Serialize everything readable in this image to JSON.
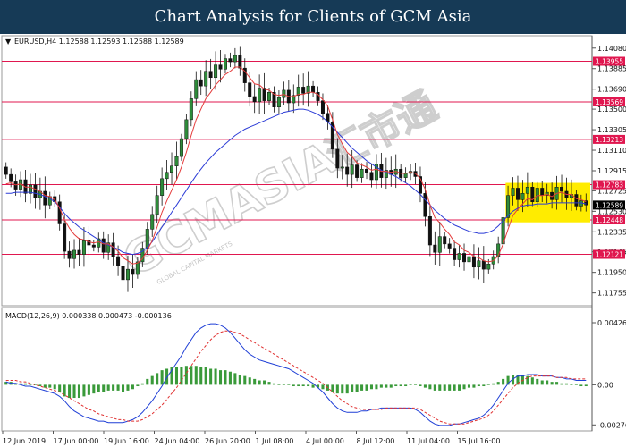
{
  "banner": {
    "title": "Chart Analysis for Clients of GCM Asia"
  },
  "watermark": {
    "brand": "GCMASIA",
    "chinese": "汇市通",
    "tagline": "GLOBAL CAPITAL MARKETS"
  },
  "colors": {
    "level_line": "#e0174f",
    "ma_fast": "#e43b3b",
    "ma_slow": "#2b3bd6",
    "candle_bull": "#2e8b3a",
    "candle_bear": "#111111",
    "macd_hist": "#3a9a3a",
    "macd_main": "#1f3fd6",
    "macd_signal": "#e03030",
    "highlight": "#ffec00",
    "banner_bg": "#163a56"
  },
  "chart_data": [
    {
      "type": "candlestick",
      "header": "EURUSD,H4  1.12588 1.12593 1.12588 1.12589",
      "ylim": [
        1.1165,
        1.1418
      ],
      "y_ticks": [
        "1.14080",
        "1.13885",
        "1.13690",
        "1.13500",
        "1.13305",
        "1.13110",
        "1.12915",
        "1.12725",
        "1.12530",
        "1.12335",
        "1.12145",
        "1.11950",
        "1.11755"
      ],
      "levels": [
        "1.13955",
        "1.13569",
        "1.13213",
        "1.12783",
        "1.12448",
        "1.12121"
      ],
      "current_price": "1.12589",
      "x_ticks": [
        "12 Jun 2019",
        "17 Jun 00:00",
        "19 Jun 16:00",
        "24 Jun 04:00",
        "26 Jun 20:00",
        "1 Jul 08:00",
        "4 Jul 00:00",
        "8 Jul 12:00",
        "11 Jul 04:00",
        "15 Jul 16:00"
      ],
      "closes": [
        1.1288,
        1.1281,
        1.1274,
        1.1283,
        1.127,
        1.1278,
        1.1266,
        1.1272,
        1.1259,
        1.1267,
        1.1262,
        1.1241,
        1.1215,
        1.1208,
        1.1216,
        1.1212,
        1.1225,
        1.1221,
        1.1219,
        1.1227,
        1.1214,
        1.1223,
        1.121,
        1.1201,
        1.1188,
        1.1198,
        1.1193,
        1.1205,
        1.1218,
        1.1236,
        1.125,
        1.1268,
        1.1284,
        1.129,
        1.1296,
        1.1305,
        1.1322,
        1.134,
        1.136,
        1.1378,
        1.1372,
        1.1386,
        1.138,
        1.1392,
        1.1388,
        1.1398,
        1.1395,
        1.1401,
        1.1389,
        1.1375,
        1.1362,
        1.1357,
        1.137,
        1.1358,
        1.1366,
        1.1352,
        1.1361,
        1.1368,
        1.1356,
        1.1363,
        1.1371,
        1.1365,
        1.1372,
        1.1366,
        1.1358,
        1.1346,
        1.1338,
        1.1312,
        1.1294,
        1.1295,
        1.1288,
        1.1297,
        1.1285,
        1.1293,
        1.129,
        1.1283,
        1.1298,
        1.1285,
        1.1292,
        1.1288,
        1.1293,
        1.1285,
        1.1289,
        1.1291,
        1.1286,
        1.127,
        1.1248,
        1.1221,
        1.1214,
        1.1229,
        1.1222,
        1.1218,
        1.1207,
        1.1213,
        1.1205,
        1.121,
        1.12,
        1.1206,
        1.1198,
        1.1203,
        1.121,
        1.1222,
        1.1247,
        1.1268,
        1.1275,
        1.1264,
        1.127,
        1.1276,
        1.1262,
        1.1275,
        1.1268,
        1.1271,
        1.1264,
        1.1276,
        1.1272,
        1.1266,
        1.1269,
        1.1258,
        1.1263,
        1.1259
      ],
      "ma_fast": [
        1.1279,
        1.128,
        1.1278,
        1.1279,
        1.1276,
        1.1276,
        1.1274,
        1.1272,
        1.1268,
        1.1267,
        1.1264,
        1.1256,
        1.1245,
        1.1237,
        1.1231,
        1.1227,
        1.1226,
        1.1224,
        1.1223,
        1.1224,
        1.1222,
        1.1222,
        1.1219,
        1.1215,
        1.1209,
        1.1206,
        1.1203,
        1.1204,
        1.1208,
        1.1216,
        1.1225,
        1.1238,
        1.1252,
        1.1263,
        1.1273,
        1.1283,
        1.1295,
        1.1309,
        1.1325,
        1.134,
        1.135,
        1.136,
        1.1366,
        1.1373,
        1.1378,
        1.1383,
        1.1386,
        1.139,
        1.139,
        1.1386,
        1.138,
        1.1374,
        1.1373,
        1.1369,
        1.1368,
        1.1364,
        1.1363,
        1.1364,
        1.1362,
        1.1362,
        1.1364,
        1.1364,
        1.1366,
        1.1366,
        1.1364,
        1.1359,
        1.1353,
        1.134,
        1.1326,
        1.1317,
        1.1309,
        1.1305,
        1.1299,
        1.1297,
        1.1295,
        1.1292,
        1.1293,
        1.1291,
        1.1291,
        1.129,
        1.1291,
        1.1289,
        1.1289,
        1.129,
        1.1289,
        1.1284,
        1.1274,
        1.1259,
        1.1247,
        1.1242,
        1.1236,
        1.1231,
        1.1224,
        1.1221,
        1.1216,
        1.1214,
        1.121,
        1.1209,
        1.1206,
        1.1205,
        1.1206,
        1.1211,
        1.1222,
        1.1236,
        1.1249,
        1.1255,
        1.126,
        1.1265,
        1.1264,
        1.1268,
        1.1268,
        1.1269,
        1.1267,
        1.127,
        1.1271,
        1.1269,
        1.1269,
        1.1265,
        1.1264,
        1.1262
      ],
      "ma_slow": [
        1.127,
        1.127,
        1.1271,
        1.1271,
        1.1271,
        1.1271,
        1.127,
        1.1269,
        1.1267,
        1.1265,
        1.1262,
        1.1257,
        1.1251,
        1.1246,
        1.1242,
        1.1238,
        1.1235,
        1.1232,
        1.1229,
        1.1226,
        1.1223,
        1.1221,
        1.1219,
        1.1217,
        1.1214,
        1.1213,
        1.1212,
        1.1213,
        1.1215,
        1.1219,
        1.1224,
        1.1231,
        1.1238,
        1.1245,
        1.1252,
        1.1259,
        1.1266,
        1.1273,
        1.128,
        1.1287,
        1.1293,
        1.1299,
        1.1304,
        1.1309,
        1.1313,
        1.1317,
        1.1321,
        1.1325,
        1.1328,
        1.1331,
        1.1333,
        1.1335,
        1.1337,
        1.1339,
        1.1341,
        1.1343,
        1.1345,
        1.1347,
        1.1348,
        1.1349,
        1.135,
        1.135,
        1.1349,
        1.1347,
        1.1345,
        1.1342,
        1.1338,
        1.1333,
        1.1328,
        1.1323,
        1.1318,
        1.1313,
        1.1309,
        1.1305,
        1.1301,
        1.1298,
        1.1295,
        1.1292,
        1.129,
        1.1288,
        1.1286,
        1.1283,
        1.128,
        1.1277,
        1.1273,
        1.1269,
        1.1264,
        1.1259,
        1.1254,
        1.125,
        1.1246,
        1.1243,
        1.124,
        1.1238,
        1.1236,
        1.1234,
        1.1233,
        1.1232,
        1.1232,
        1.1233,
        1.1235,
        1.1239,
        1.1244,
        1.1249,
        1.1253,
        1.1256,
        1.1258,
        1.1259,
        1.1259,
        1.126,
        1.126,
        1.126,
        1.1261,
        1.1261,
        1.1261,
        1.1261,
        1.1261,
        1.1261,
        1.1261,
        1.126
      ]
    },
    {
      "type": "bar",
      "header": "MACD(12,26,9) 0.000338 0.000473 -0.000136",
      "ylim": [
        -0.00305,
        0.00445
      ],
      "y_ticks": [
        "0.004266",
        "0.00",
        "-0.002761"
      ],
      "histogram": [
        0.0002,
        0.0002,
        0.0001,
        0.0001,
        0.0001,
        0.0,
        0.0,
        -0.0001,
        -0.0002,
        -0.0002,
        -0.0003,
        -0.0005,
        -0.0008,
        -0.0009,
        -0.0009,
        -0.0009,
        -0.0008,
        -0.0007,
        -0.0006,
        -0.0005,
        -0.0005,
        -0.0004,
        -0.0004,
        -0.0004,
        -0.0005,
        -0.0004,
        -0.0003,
        -0.0001,
        0.0001,
        0.0004,
        0.0006,
        0.0008,
        0.001,
        0.0011,
        0.0012,
        0.0012,
        0.0012,
        0.0013,
        0.0013,
        0.0013,
        0.0012,
        0.0012,
        0.0011,
        0.0011,
        0.001,
        0.001,
        0.0009,
        0.0008,
        0.0007,
        0.0006,
        0.0005,
        0.0004,
        0.0003,
        0.0003,
        0.0002,
        0.0001,
        0.0,
        0.0,
        0.0,
        -0.0001,
        -0.0001,
        -0.0001,
        -0.0001,
        -0.0002,
        -0.0002,
        -0.0003,
        -0.0004,
        -0.0005,
        -0.0006,
        -0.0006,
        -0.0006,
        -0.0005,
        -0.0005,
        -0.0004,
        -0.0004,
        -0.0003,
        -0.0003,
        -0.0002,
        -0.0002,
        -0.0002,
        -0.0001,
        -0.0001,
        -0.0001,
        0.0,
        0.0,
        -0.0001,
        -0.0002,
        -0.0003,
        -0.0004,
        -0.0004,
        -0.0004,
        -0.0004,
        -0.0004,
        -0.0004,
        -0.0003,
        -0.0002,
        -0.0002,
        -0.0001,
        -0.0001,
        0.0,
        0.0001,
        0.0002,
        0.0004,
        0.0006,
        0.0007,
        0.0007,
        0.0007,
        0.0006,
        0.0005,
        0.0004,
        0.0003,
        0.0003,
        0.0002,
        0.0002,
        0.0001,
        0.0001,
        0.0,
        0.0,
        -0.0001,
        -0.0001
      ],
      "macd": [
        0.0002,
        0.0001,
        0.0001,
        0.0,
        -0.0001,
        -0.0001,
        -0.0002,
        -0.0003,
        -0.0004,
        -0.0005,
        -0.0006,
        -0.0008,
        -0.0011,
        -0.0015,
        -0.0018,
        -0.002,
        -0.0022,
        -0.0023,
        -0.0024,
        -0.0025,
        -0.0025,
        -0.0026,
        -0.0026,
        -0.0026,
        -0.0026,
        -0.0025,
        -0.0024,
        -0.0022,
        -0.0019,
        -0.0015,
        -0.0011,
        -0.0006,
        -0.0001,
        0.0005,
        0.001,
        0.0015,
        0.002,
        0.0026,
        0.0031,
        0.0036,
        0.0039,
        0.0041,
        0.0042,
        0.0042,
        0.0041,
        0.0039,
        0.0036,
        0.0032,
        0.0028,
        0.0024,
        0.0021,
        0.0019,
        0.0017,
        0.0016,
        0.0015,
        0.0014,
        0.0013,
        0.0012,
        0.0011,
        0.0009,
        0.0007,
        0.0005,
        0.0003,
        0.0001,
        -0.0002,
        -0.0005,
        -0.0009,
        -0.0013,
        -0.0016,
        -0.0018,
        -0.0019,
        -0.0019,
        -0.0019,
        -0.0018,
        -0.0018,
        -0.0017,
        -0.0017,
        -0.0016,
        -0.0016,
        -0.0016,
        -0.0016,
        -0.0016,
        -0.0016,
        -0.0016,
        -0.0017,
        -0.0019,
        -0.0022,
        -0.0025,
        -0.0027,
        -0.0028,
        -0.0028,
        -0.0028,
        -0.0027,
        -0.0027,
        -0.0026,
        -0.0025,
        -0.0024,
        -0.0023,
        -0.0021,
        -0.0018,
        -0.0014,
        -0.0009,
        -0.0004,
        0.0001,
        0.0004,
        0.0006,
        0.0006,
        0.0007,
        0.0007,
        0.0007,
        0.0006,
        0.0006,
        0.0006,
        0.0005,
        0.0005,
        0.0004,
        0.0004,
        0.0003,
        0.0003,
        0.0003
      ],
      "signal": [
        0.0003,
        0.0003,
        0.0003,
        0.0002,
        0.0002,
        0.0001,
        0.0,
        -0.0001,
        -0.0002,
        -0.0003,
        -0.0004,
        -0.0005,
        -0.0007,
        -0.0009,
        -0.0011,
        -0.0013,
        -0.0015,
        -0.0017,
        -0.0018,
        -0.002,
        -0.0021,
        -0.0022,
        -0.0023,
        -0.0024,
        -0.0024,
        -0.0025,
        -0.0025,
        -0.0025,
        -0.0024,
        -0.0022,
        -0.002,
        -0.0017,
        -0.0014,
        -0.001,
        -0.0006,
        -0.0002,
        0.0003,
        0.0008,
        0.0013,
        0.0018,
        0.0023,
        0.0027,
        0.0031,
        0.0034,
        0.0036,
        0.0037,
        0.0037,
        0.0036,
        0.0035,
        0.0033,
        0.0031,
        0.0029,
        0.0027,
        0.0025,
        0.0023,
        0.0021,
        0.0019,
        0.0017,
        0.0015,
        0.0013,
        0.0011,
        0.0009,
        0.0007,
        0.0005,
        0.0003,
        0.0001,
        -0.0002,
        -0.0005,
        -0.0008,
        -0.0011,
        -0.0013,
        -0.0015,
        -0.0016,
        -0.0017,
        -0.0017,
        -0.0017,
        -0.0017,
        -0.0017,
        -0.0016,
        -0.0016,
        -0.0016,
        -0.0016,
        -0.0016,
        -0.0016,
        -0.0016,
        -0.0017,
        -0.0019,
        -0.0021,
        -0.0023,
        -0.0025,
        -0.0026,
        -0.0027,
        -0.0027,
        -0.0027,
        -0.0027,
        -0.0026,
        -0.0025,
        -0.0024,
        -0.0023,
        -0.0021,
        -0.0018,
        -0.0014,
        -0.001,
        -0.0006,
        -0.0002,
        0.0001,
        0.0003,
        0.0005,
        0.0006,
        0.0006,
        0.0006,
        0.0006,
        0.0006,
        0.0005,
        0.0005,
        0.0005,
        0.0004,
        0.0004,
        0.0004,
        0.0004
      ]
    }
  ]
}
